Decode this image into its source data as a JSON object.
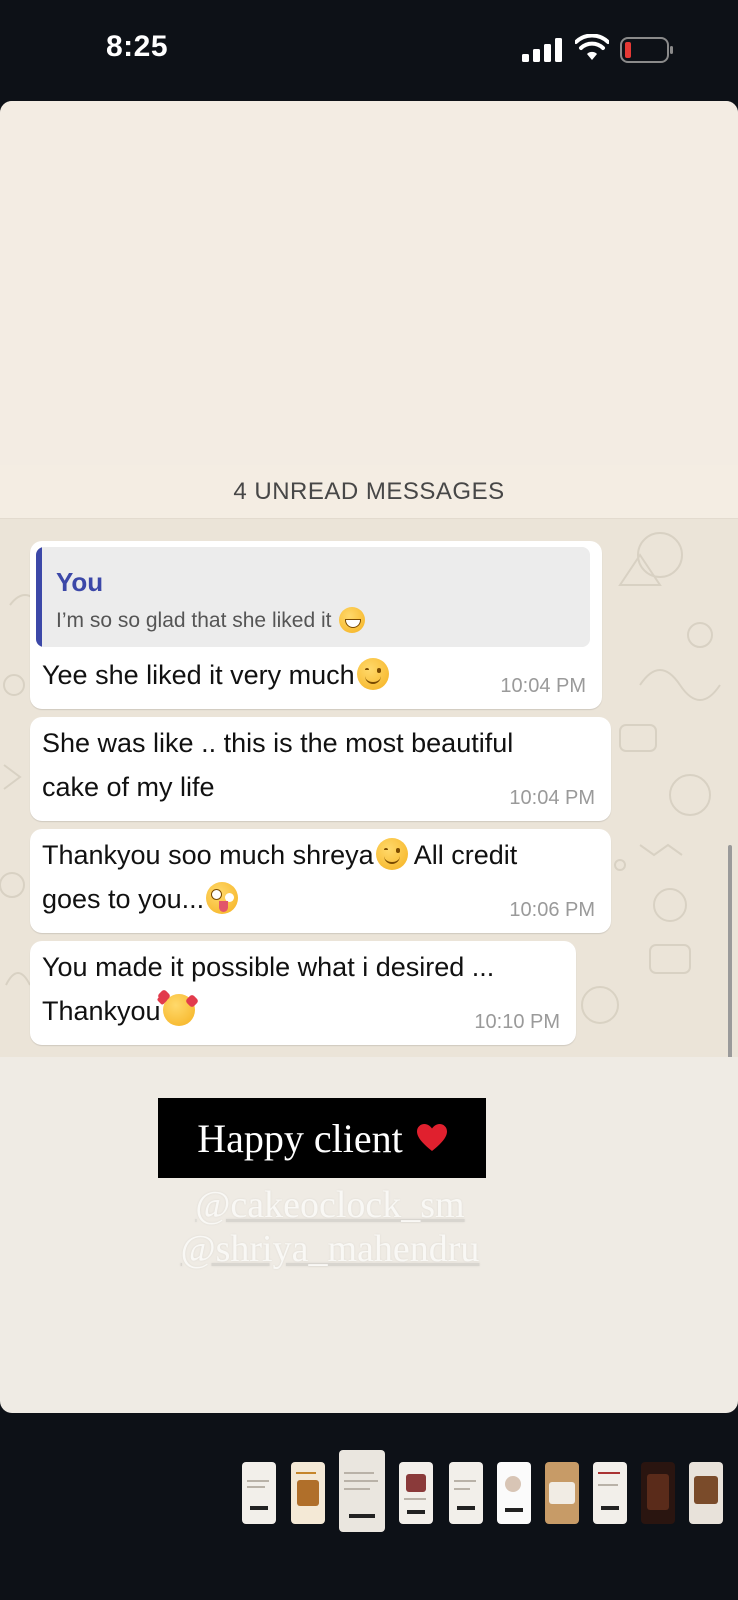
{
  "status_bar": {
    "time": "8:25"
  },
  "chat": {
    "unread_banner": "4 UNREAD MESSAGES",
    "messages": [
      {
        "quote": {
          "author": "You",
          "text": "I’m so so glad that she liked it"
        },
        "text": "Yee she liked it very much",
        "time": "10:04 PM"
      },
      {
        "text_line1": "She was like .. this is the most beautiful",
        "text_line2": "cake of my life",
        "time": "10:04 PM"
      },
      {
        "text_line1": "Thankyou soo much shreya",
        "text_line1b": "All credit",
        "text_line2": "goes to you...",
        "time": "10:06 PM"
      },
      {
        "text_line1": "You made it possible what i desired ...",
        "text_line2": "Thankyou",
        "time": "10:10 PM"
      }
    ]
  },
  "story": {
    "caption": "Happy client",
    "mentions": [
      "@cakeoclock_sm",
      "@shriya_mahendru"
    ]
  },
  "icons": {
    "signal": "cellular-signal-icon",
    "wifi": "wifi-icon",
    "battery": "battery-low-icon",
    "heart": "red-heart-icon"
  },
  "colors": {
    "status_bar_bg": "#0d1117",
    "quote_accent": "#3c48a8",
    "battery_low": "#e53935",
    "heart": "#e0202e",
    "caption_bg": "#000000"
  }
}
